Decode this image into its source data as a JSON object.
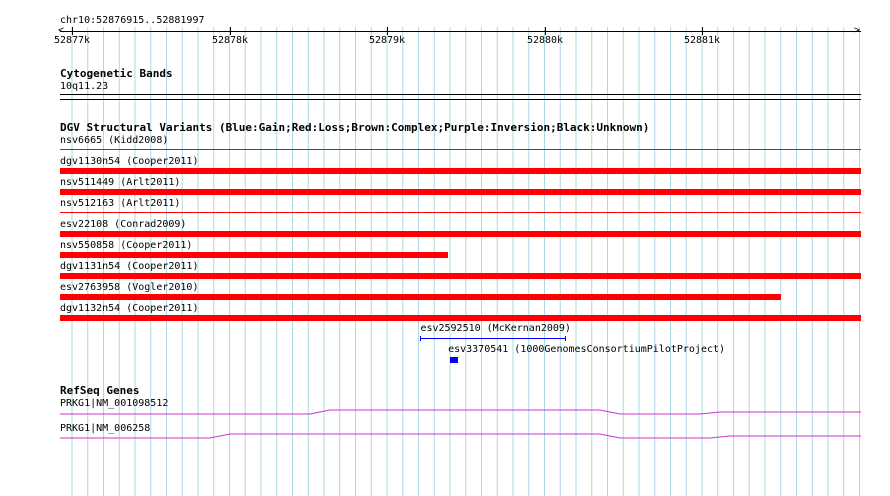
{
  "ruler": {
    "location": "chr10:52876915..52881997",
    "ticks": [
      "52877k",
      "52878k",
      "52879k",
      "52880k",
      "52881k"
    ]
  },
  "cytoband": {
    "title": "Cytogenetic Bands",
    "band": "10q11.23"
  },
  "dgv": {
    "title": "DGV Structural Variants (Blue:Gain;Red:Loss;Brown:Complex;Purple:Inversion;Black:Unknown)",
    "variants": [
      {
        "label": "nsv6665 (Kidd2008)",
        "color": "#ff0000",
        "start": 0.0,
        "end": 1.0,
        "style": "line"
      },
      {
        "label": "dgv1130n54 (Cooper2011)",
        "color": "#ff0000",
        "start": 0.0,
        "end": 1.0,
        "style": "bar"
      },
      {
        "label": "nsv511449 (Arlt2011)",
        "color": "#ff0000",
        "start": 0.0,
        "end": 1.0,
        "style": "bar"
      },
      {
        "label": "nsv512163 (Arlt2011)",
        "color": "#ff0000",
        "start": 0.0,
        "end": 1.0,
        "style": "line"
      },
      {
        "label": "esv22108 (Conrad2009)",
        "color": "#ff0000",
        "start": 0.0,
        "end": 1.0,
        "style": "bar"
      },
      {
        "label": "nsv550858 (Cooper2011)",
        "color": "#ff0000",
        "start": 0.0,
        "end": 0.485,
        "style": "bar"
      },
      {
        "label": "dgv1131n54 (Cooper2011)",
        "color": "#ff0000",
        "start": 0.0,
        "end": 1.0,
        "style": "bar"
      },
      {
        "label": "esv2763958 (Vogler2010)",
        "color": "#ff0000",
        "start": 0.0,
        "end": 0.9,
        "style": "bar"
      },
      {
        "label": "dgv1132n54 (Cooper2011)",
        "color": "#ff0000",
        "start": 0.0,
        "end": 1.0,
        "style": "bar"
      }
    ],
    "extra": [
      {
        "label": "esv2592510 (McKernan2009)",
        "color": "#0000ff",
        "start": 0.45,
        "end": 0.63
      },
      {
        "label": "esv3370541 (1000GenomesConsortiumPilotProject)",
        "color": "#0000ff",
        "start": 0.487,
        "end": 0.497
      }
    ]
  },
  "refseq": {
    "title": "RefSeq Genes",
    "genes": [
      {
        "label": "PRKG1|NM_001098512",
        "color": "#cc33cc"
      },
      {
        "label": "PRKG1|NM_006258",
        "color": "#cc33cc"
      }
    ]
  }
}
